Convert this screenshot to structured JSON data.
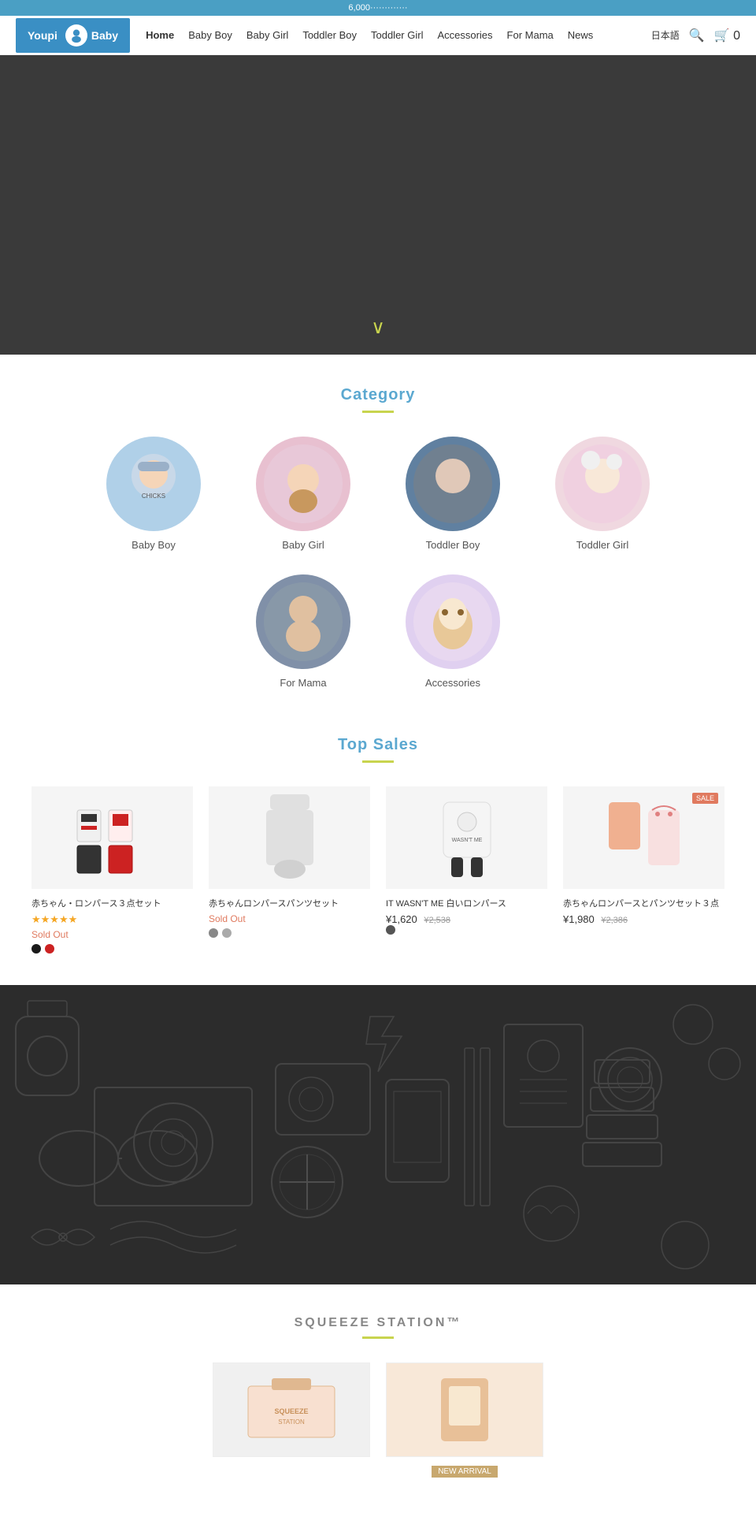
{
  "announcement": {
    "text": "6,000·············"
  },
  "header": {
    "logo_brand": "Youpi",
    "logo_sub": "Baby",
    "nav_items": [
      {
        "label": "Home",
        "active": true
      },
      {
        "label": "Baby Boy"
      },
      {
        "label": "Baby Girl"
      },
      {
        "label": "Toddler Boy"
      },
      {
        "label": "Toddler Girl"
      },
      {
        "label": "Accessories"
      },
      {
        "label": "For Mama"
      },
      {
        "label": "News"
      }
    ],
    "lang": "日本語",
    "cart_count": "0"
  },
  "hero": {
    "chevron": "∨"
  },
  "category": {
    "title": "Category",
    "items": [
      {
        "label": "Baby Boy",
        "color": "blue",
        "emoji": "👶"
      },
      {
        "label": "Baby Girl",
        "color": "pink",
        "emoji": "👧"
      },
      {
        "label": "Toddler Boy",
        "color": "darkblue",
        "emoji": "🧒"
      },
      {
        "label": "Toddler Girl",
        "color": "lightpink",
        "emoji": "👧"
      },
      {
        "label": "For Mama",
        "color": "slate",
        "emoji": "👩"
      },
      {
        "label": "Accessories",
        "color": "lightpurple",
        "emoji": "🧸"
      }
    ]
  },
  "top_sales": {
    "title": "Top Sales",
    "products": [
      {
        "name": "赤ちゃん・ロンパース３点セット",
        "stars": "★★★★★",
        "status": "Sold Out",
        "colors": [
          "#1a1a1a",
          "#cc2222"
        ],
        "emoji": "👕",
        "has_badge": false
      },
      {
        "name": "赤ちゃんロンパースパンツセット",
        "status": "Sold Out",
        "colors": [
          "#888",
          "#aaa"
        ],
        "emoji": "👖",
        "has_badge": false
      },
      {
        "name": "IT WASN'T ME 白いロンパース",
        "price_sale": "¥1,620",
        "price_original": "¥2,538",
        "colors": [
          "#555"
        ],
        "emoji": "🍼",
        "has_badge": false
      },
      {
        "name": "赤ちゃんロンパースとパンツセット３点",
        "price_sale": "¥1,980",
        "price_original": "¥2,386",
        "emoji": "👗",
        "has_badge": true,
        "badge_text": "SALE"
      }
    ]
  },
  "dark_section": {
    "description": "Dark decorative pattern section"
  },
  "squeeze_station": {
    "title": "SQUEEZE STATION™",
    "items": [
      {
        "label": "Squeeze Station Logo",
        "emoji": "🏪",
        "has_badge": false
      },
      {
        "label": "Product",
        "emoji": "🛍️",
        "has_badge": true,
        "badge_text": "NEW ARRIVAL"
      }
    ]
  }
}
